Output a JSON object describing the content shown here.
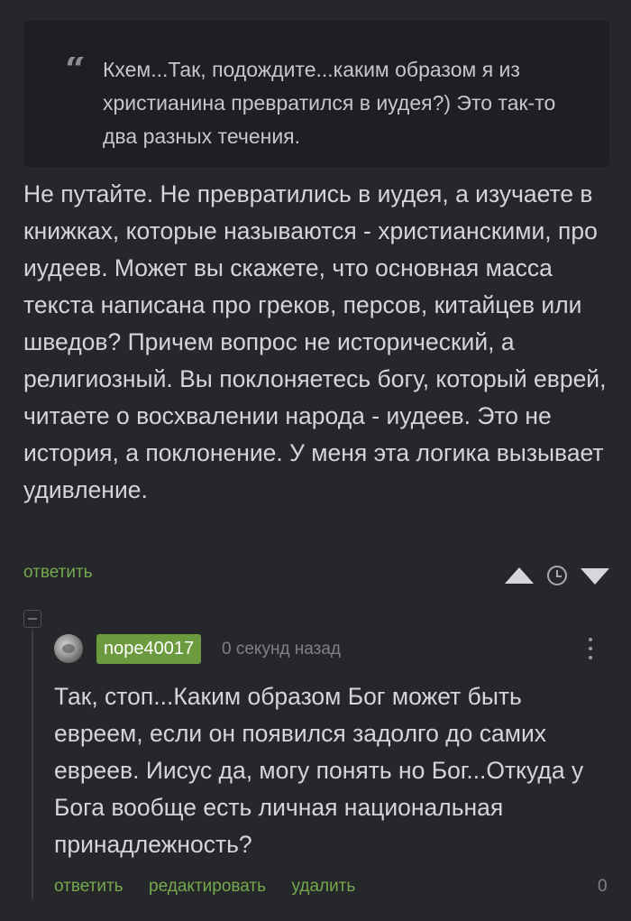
{
  "quote": {
    "text": "Кхем...Так, подождите...каким образом я из христианина превратился в иудея?) Это так-то два разных течения."
  },
  "main_comment": {
    "text": "Не путайте. Не превратились в иудея, а изучаете в книжках, которые называются - христианскими, про иудеев. Может вы скажете, что основная масса текста написана про греков, персов, китайцев или шведов? Причем вопрос не исторический, а религиозный. Вы поклоняетесь богу, который еврей, читаете о восхвалении народа - иудеев. Это не история, а поклонение. У меня эта логика вызывает удивление.",
    "reply_label": "ответить"
  },
  "rating": {
    "upvote_icon": "triangle-up-icon",
    "clock_icon": "clock-icon",
    "downvote_icon": "triangle-down-icon"
  },
  "reply": {
    "username": "nope40017",
    "timestamp": "0 секунд назад",
    "text": "Так, стоп...Каким образом Бог может быть евреем, если он появился задолго до самих евреев. Иисус да, могу понять но Бог...Откуда у Бога вообще есть личная национальная принадлежность?",
    "actions": {
      "reply": "ответить",
      "edit": "редактировать",
      "delete": "удалить"
    },
    "score": "0"
  },
  "colors": {
    "background": "#26272b",
    "quote_background": "#1e1f23",
    "accent_green": "#74a84c",
    "badge_green": "#6c9b3f"
  }
}
